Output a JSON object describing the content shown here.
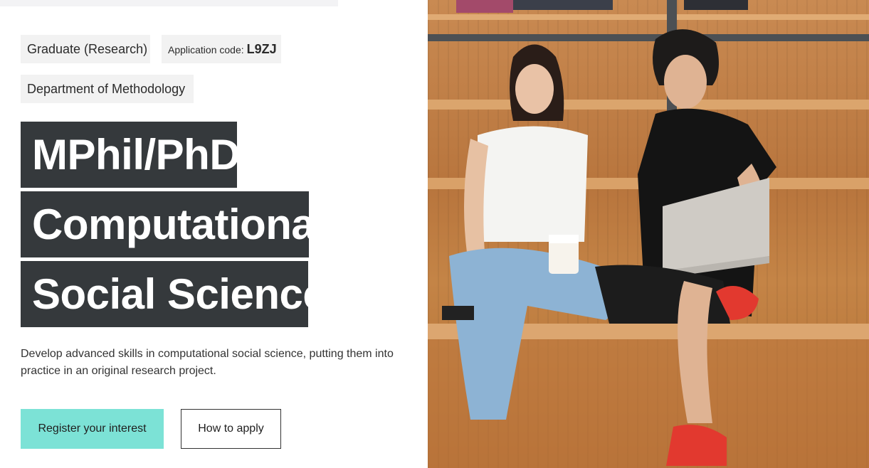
{
  "tags": {
    "level": "Graduate (Research)",
    "code_label": "Application code:",
    "code_value": "L9ZJ",
    "department": "Department of Methodology"
  },
  "title": {
    "line1": "MPhil/PhD",
    "line2": "Computational",
    "line3": "Social Science"
  },
  "description": "Develop advanced skills in computational social science, putting them into practice in an original research project.",
  "buttons": {
    "register": "Register your interest",
    "apply": "How to apply"
  },
  "colors": {
    "accent": "#7ce2d6",
    "title_bg": "#35393c"
  },
  "photo": {
    "alt_icon": "students-photo"
  }
}
